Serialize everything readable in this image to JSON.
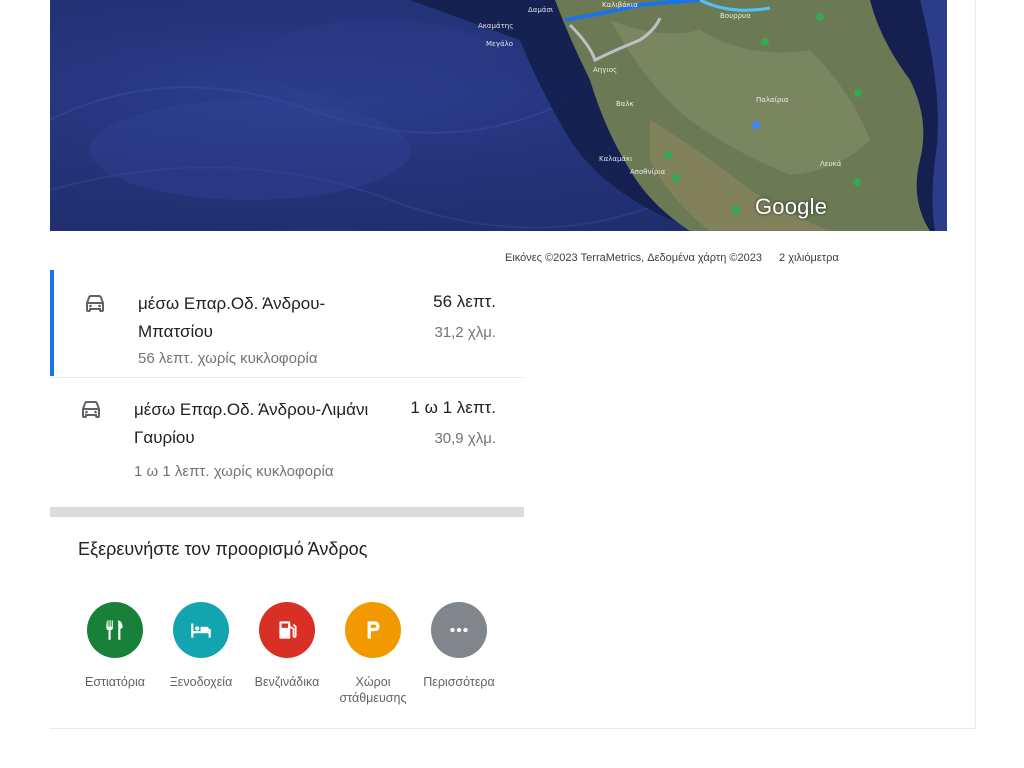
{
  "map": {
    "labels": [
      "Ακαμάτης",
      "Μεγάλο",
      "Δαμάσι",
      "Καλιβάκια",
      "Βουρρυα",
      "Αηγιος",
      "Βαλκ",
      "Παλαίρια",
      "Καλαμάκι",
      "Αποθνίρια",
      "Λευκά"
    ],
    "google_logo": "Google",
    "colors": {
      "route_primary": "#1a73e8",
      "route_secondary": "#9aa0a6"
    }
  },
  "attribution": {
    "imagery": "Εικόνες ©2023 TerraMetrics, Δεδομένα χάρτη ©2023",
    "scale": "2 χιλιόμετρα"
  },
  "routes": [
    {
      "name": "μέσω Επαρ.Οδ. Άνδρου-Μπατσίου",
      "time": "56 λεπτ.",
      "distance": "31,2 χλμ.",
      "traffic": "56 λεπτ. χωρίς κυκλοφορία",
      "icon": "car-icon"
    },
    {
      "name": "μέσω Επαρ.Οδ. Άνδρου-Λιμάνι Γαυρίου",
      "time": "1 ω 1 λεπτ.",
      "distance": "30,9 χλμ.",
      "traffic": "1 ω 1 λεπτ. χωρίς κυκλοφορία",
      "icon": "car-icon"
    }
  ],
  "explore": {
    "title": "Εξερευνήστε τον προορισμό Άνδρος",
    "categories": [
      {
        "label": "Εστιατόρια",
        "icon": "restaurant-icon",
        "color": "#188038"
      },
      {
        "label": "Ξενοδοχεία",
        "icon": "hotel-icon",
        "color": "#12a4af"
      },
      {
        "label": "Βενζινάδικα",
        "icon": "gas-station-icon",
        "color": "#d93025"
      },
      {
        "label": "Χώροι στάθμευσης",
        "icon": "parking-icon",
        "color": "#f29900"
      },
      {
        "label": "Περισσότερα",
        "icon": "more-icon",
        "color": "#80868b"
      }
    ]
  }
}
